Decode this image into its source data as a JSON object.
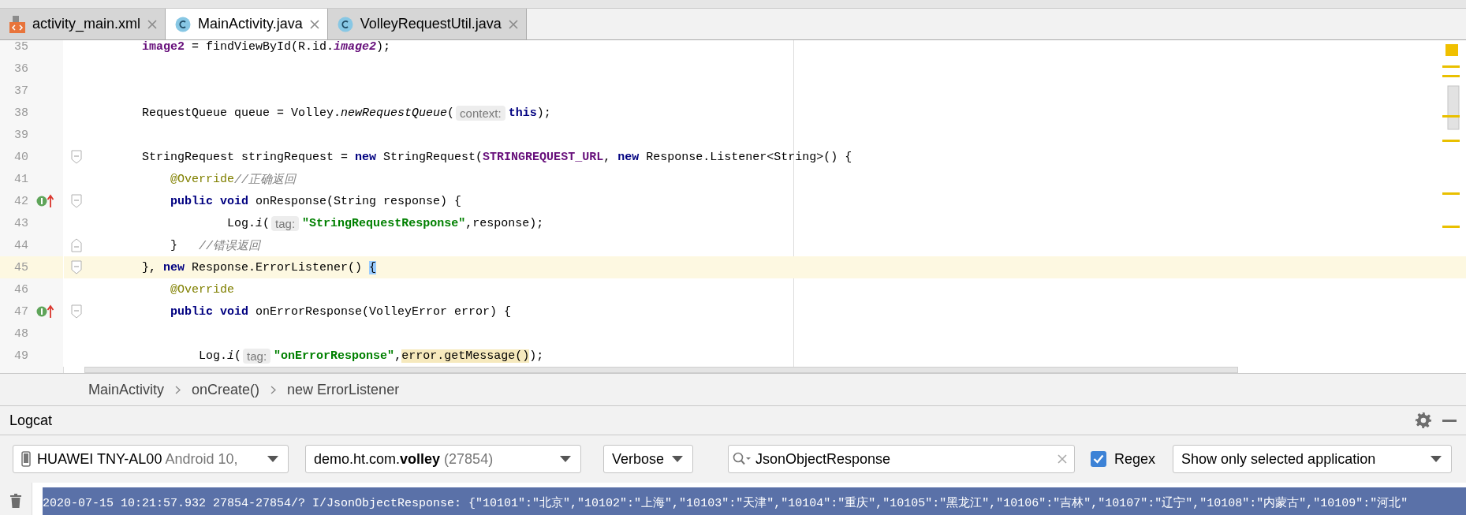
{
  "tabs": [
    {
      "label": "activity_main.xml",
      "kind": "xml",
      "selected": false
    },
    {
      "label": "MainActivity.java",
      "kind": "class",
      "selected": true
    },
    {
      "label": "VolleyRequestUtil.java",
      "kind": "class",
      "selected": false
    }
  ],
  "editor": {
    "lines": [
      {
        "number": "35",
        "current": false,
        "tokens": [
          {
            "kind": "field",
            "text": "        image2"
          },
          {
            "kind": "plain",
            "text": " = findViewById(R.id."
          },
          {
            "kind": "static_field",
            "text": "image2"
          },
          {
            "kind": "plain",
            "text": ");"
          }
        ]
      },
      {
        "number": "36",
        "current": false
      },
      {
        "number": "37",
        "current": false
      },
      {
        "number": "38",
        "current": false,
        "tokens": [
          {
            "kind": "plain",
            "text": "        RequestQueue queue = Volley."
          },
          {
            "kind": "static",
            "text": "newRequestQueue"
          },
          {
            "kind": "plain",
            "text": "("
          },
          {
            "kind": "hint",
            "text": "context:"
          },
          {
            "kind": "keyword",
            "text": "this"
          },
          {
            "kind": "plain",
            "text": ");"
          }
        ]
      },
      {
        "number": "39",
        "current": false
      },
      {
        "number": "40",
        "current": false,
        "fold": {
          "kind": "start"
        },
        "tokens": [
          {
            "kind": "plain",
            "text": "        StringRequest stringRequest = "
          },
          {
            "kind": "keyword",
            "text": "new"
          },
          {
            "kind": "plain",
            "text": " StringRequest("
          },
          {
            "kind": "field",
            "text": "STRINGREQUEST_URL"
          },
          {
            "kind": "plain",
            "text": ", "
          },
          {
            "kind": "keyword",
            "text": "new"
          },
          {
            "kind": "plain",
            "text": " Response.Listener<String>() {"
          }
        ]
      },
      {
        "number": "41",
        "current": false,
        "tokens": [
          {
            "kind": "annotation",
            "text": "            @Override"
          },
          {
            "kind": "comment",
            "text": "//正确返回"
          }
        ]
      },
      {
        "number": "42",
        "current": false,
        "marker": {
          "kind": "implements"
        },
        "fold": {
          "kind": "start"
        },
        "tokens": [
          {
            "kind": "keyword",
            "text": "            public void"
          },
          {
            "kind": "plain",
            "text": " onResponse(String response) {"
          }
        ]
      },
      {
        "number": "43",
        "current": false,
        "tokens": [
          {
            "kind": "plain",
            "text": "                    Log."
          },
          {
            "kind": "static",
            "text": "i"
          },
          {
            "kind": "plain",
            "text": "("
          },
          {
            "kind": "hint",
            "text": "tag:"
          },
          {
            "kind": "string",
            "text": "\"StringRequestResponse\""
          },
          {
            "kind": "plain",
            "text": ",response);"
          }
        ]
      },
      {
        "number": "44",
        "current": false,
        "fold": {
          "kind": "end"
        },
        "tokens": [
          {
            "kind": "plain",
            "text": "            }   "
          },
          {
            "kind": "comment",
            "text": "//错误返回"
          }
        ]
      },
      {
        "number": "45",
        "current": true,
        "fold": {
          "kind": "start"
        },
        "tokens": [
          {
            "kind": "plain",
            "text": "        }, "
          },
          {
            "kind": "keyword",
            "text": "new"
          },
          {
            "kind": "plain",
            "text": " Response.ErrorListener() "
          },
          {
            "kind": "brace_match",
            "text": "{"
          }
        ]
      },
      {
        "number": "46",
        "current": false,
        "tokens": [
          {
            "kind": "annotation",
            "text": "            @Override"
          }
        ]
      },
      {
        "number": "47",
        "current": false,
        "marker": {
          "kind": "implements"
        },
        "fold": {
          "kind": "start"
        },
        "tokens": [
          {
            "kind": "keyword",
            "text": "            public void"
          },
          {
            "kind": "plain",
            "text": " onErrorResponse(VolleyError error) {"
          }
        ]
      },
      {
        "number": "48",
        "current": false
      },
      {
        "number": "49",
        "current": false,
        "tokens": [
          {
            "kind": "plain",
            "text": "                Log."
          },
          {
            "kind": "static",
            "text": "i"
          },
          {
            "kind": "plain",
            "text": "("
          },
          {
            "kind": "hint",
            "text": "tag:"
          },
          {
            "kind": "string",
            "text": "\"onErrorResponse\""
          },
          {
            "kind": "plain",
            "text": ","
          },
          {
            "kind": "match",
            "text": "error.getMessage()"
          },
          {
            "kind": "plain",
            "text": ");"
          }
        ]
      }
    ]
  },
  "breadcrumbs": [
    "MainActivity",
    "onCreate()",
    "new ErrorListener"
  ],
  "logcat": {
    "title": "Logcat",
    "device": {
      "name": "HUAWEI TNY-AL00",
      "detail": "Android 10,"
    },
    "process": {
      "name": "demo.ht.com.**volley**",
      "pid": "(27854)"
    },
    "level": "Verbose",
    "search": {
      "value": "JsonObjectResponse"
    },
    "regex": {
      "label": "Regex",
      "checked": true
    },
    "filter": "Show only selected application",
    "rows": [
      {
        "text": "2020-07-15 10:21:57.932 27854-27854/? I/JsonObjectResponse: {\"10101\":\"北京\",\"10102\":\"上海\",\"10103\":\"天津\",\"10104\":\"重庆\",\"10105\":\"黑龙江\",\"10106\":\"吉林\",\"10107\":\"辽宁\",\"10108\":\"内蒙古\",\"10109\":\"河北\"",
        "selected": true
      }
    ]
  }
}
